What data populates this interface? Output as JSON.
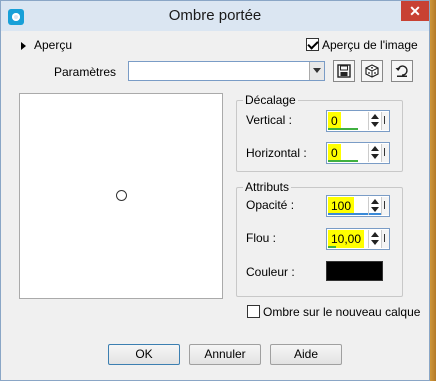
{
  "window": {
    "title": "Ombre portée",
    "close_symbol": "✕",
    "app_icon": "app-icon"
  },
  "preview": {
    "toggle_label": "Aperçu",
    "preview_image_label": "Aperçu de l'image",
    "preview_image_checked": true
  },
  "params": {
    "label": "Paramètres",
    "value": "",
    "tools": [
      "save-preset-icon",
      "random-dice-icon",
      "reset-icon"
    ]
  },
  "offset": {
    "legend": "Décalage",
    "vertical_label": "Vertical :",
    "vertical_value": "0",
    "horizontal_label": "Horizontal :",
    "horizontal_value": "0"
  },
  "attributes": {
    "legend": "Attributs",
    "opacity_label": "Opacité :",
    "opacity_value": "100",
    "blur_label": "Flou :",
    "blur_value": "10,00",
    "color_label": "Couleur :",
    "color_value": "#000000"
  },
  "new_layer": {
    "label": "Ombre sur le nouveau calque",
    "checked": false
  },
  "buttons": {
    "ok": "OK",
    "cancel": "Annuler",
    "help": "Aide"
  }
}
